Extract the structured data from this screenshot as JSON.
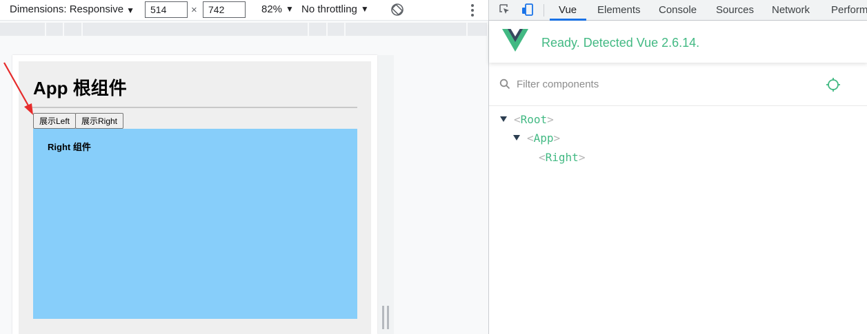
{
  "toolbar": {
    "dimensions_label": "Dimensions: Responsive",
    "width_value": "514",
    "height_value": "742",
    "times_symbol": "×",
    "zoom_label": "82%",
    "throttle_label": "No throttling",
    "caret": "▼"
  },
  "app": {
    "title": "App 根组件",
    "btn_show_left": "展示Left",
    "btn_show_right": "展示Right",
    "right_component_title": "Right 组件",
    "right_box_color": "#87cefa"
  },
  "devtools": {
    "tabs": [
      {
        "label": "Vue",
        "active": true
      },
      {
        "label": "Elements",
        "active": false
      },
      {
        "label": "Console",
        "active": false
      },
      {
        "label": "Sources",
        "active": false
      },
      {
        "label": "Network",
        "active": false
      },
      {
        "label": "Perform",
        "active": false
      }
    ],
    "vue_status": "Ready. Detected Vue 2.6.14.",
    "filter_placeholder": "Filter components",
    "tree": [
      {
        "name": "Root",
        "expanded": true
      },
      {
        "name": "App",
        "expanded": true
      },
      {
        "name": "Right",
        "expanded": false
      }
    ],
    "accent_color": "#42b983",
    "tab_active_color": "#1a73e8"
  },
  "icons": [
    "inspect-element-icon",
    "device-toggle-icon",
    "rotate-icon",
    "more-options-icon",
    "vue-logo-icon",
    "search-icon",
    "target-icon",
    "annotation-arrow"
  ],
  "brackets": {
    "open": "<",
    "close": ">"
  }
}
